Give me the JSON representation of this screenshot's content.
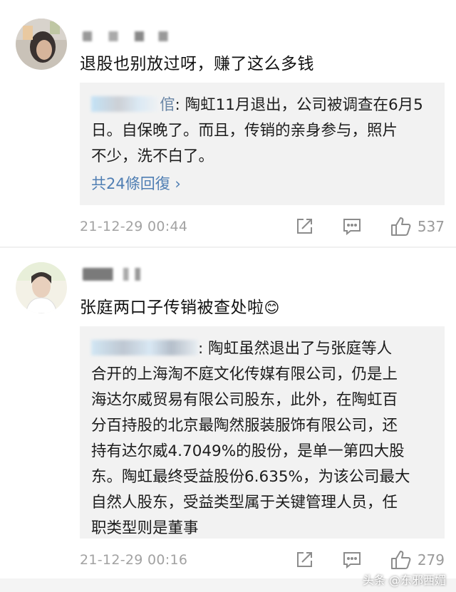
{
  "comments": [
    {
      "text": "退股也别放过呀，赚了这么多钱",
      "reply": {
        "author_tail": "倌",
        "lines": [
          ": 陶虹11月退出，公司被调查在6月5",
          "日。自保晚了。而且，传销的亲身参与，照片",
          "不少，洗不白了。"
        ],
        "more": "共24條回復 ›"
      },
      "time": "21-12-29 00:44",
      "likes": "537"
    },
    {
      "text": "张庭两口子传销被查处啦",
      "emoji": "😊",
      "reply": {
        "author_tail": "",
        "lines": [
          ": 陶虹虽然退出了与张庭等人",
          "合开的上海淘不庭文化传媒有限公司，仍是上",
          "海达尔威贸易有限公司股东，此外，在陶虹百",
          "分百持股的北京最陶然服装服饰有限公司，还",
          "持有达尔威4.7049%的股份，是单一第四大股",
          "东。陶虹最终受益股份6.635%，为该公司最大",
          "自然人股东，受益类型属于关键管理人员，任",
          "职类型则是董事"
        ],
        "more": ""
      },
      "time": "21-12-29 00:16",
      "likes": "279"
    }
  ],
  "icons": [
    "share-icon",
    "comment-icon",
    "like-icon"
  ],
  "watermark": "头条 @东邪西媚",
  "colors": {
    "reply_bg": "#f2f2f2",
    "link": "#4f7eb3",
    "meta": "#9a9a9a"
  }
}
